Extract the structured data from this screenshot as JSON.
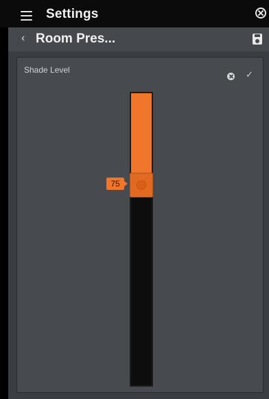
{
  "topbar": {
    "title": "Settings",
    "menu_icon": "hamburger-menu-icon",
    "close_icon": "close-circle-icon"
  },
  "subheader": {
    "back_icon": "chevron-left-icon",
    "back_glyph": "‹",
    "title": "Room Pres...",
    "save_icon": "floppy-disk-icon"
  },
  "dialog": {
    "title": "Shade Level",
    "cancel_icon": "cancel-circle-icon",
    "confirm_icon": "checkmark-icon",
    "confirm_glyph": "✓"
  },
  "slider": {
    "value": 75,
    "value_label": "75",
    "min": 0,
    "max": 100,
    "orientation": "vertical"
  },
  "colors": {
    "accent": "#f0762c",
    "dialog_bg": "#474b50",
    "track_bg": "#0d0d0d",
    "topbar_bg": "#0b0b0b"
  }
}
